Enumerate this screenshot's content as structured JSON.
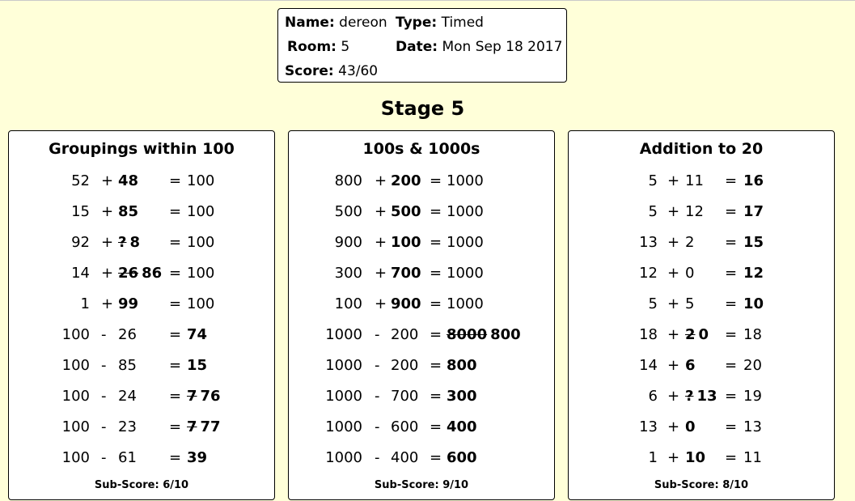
{
  "header": {
    "name_label": "Name:",
    "name_value": "dereon",
    "type_label": "Type:",
    "type_value": "Timed",
    "room_label": "Room:",
    "room_value": "5",
    "date_label": "Date:",
    "date_value": "Mon Sep 18 2017",
    "score_label": "Score:",
    "score_value": "43/60"
  },
  "stage_title": "Stage 5",
  "panels": [
    {
      "title": "Groupings within 100",
      "subscore": "Sub-Score: 6/10",
      "layout": "g1",
      "rows": [
        {
          "a": "52",
          "op": "+",
          "b": "48",
          "b_bold": true,
          "eq": "=",
          "c": "100",
          "c_bold": false,
          "wrong": ""
        },
        {
          "a": "15",
          "op": "+",
          "b": "85",
          "b_bold": true,
          "eq": "=",
          "c": "100",
          "c_bold": false,
          "wrong": ""
        },
        {
          "a": "92",
          "op": "+",
          "b": "8",
          "b_bold": true,
          "eq": "=",
          "c": "100",
          "c_bold": false,
          "wrong": "?",
          "wrong_pos": "b"
        },
        {
          "a": "14",
          "op": "+",
          "b": "86",
          "b_bold": true,
          "eq": "=",
          "c": "100",
          "c_bold": false,
          "wrong": "26",
          "wrong_pos": "b"
        },
        {
          "a": "1",
          "op": "+",
          "b": "99",
          "b_bold": true,
          "eq": "=",
          "c": "100",
          "c_bold": false,
          "wrong": ""
        },
        {
          "a": "100",
          "op": "-",
          "b": "26",
          "b_bold": false,
          "eq": "=",
          "c": "74",
          "c_bold": true,
          "wrong": ""
        },
        {
          "a": "100",
          "op": "-",
          "b": "85",
          "b_bold": false,
          "eq": "=",
          "c": "15",
          "c_bold": true,
          "wrong": ""
        },
        {
          "a": "100",
          "op": "-",
          "b": "24",
          "b_bold": false,
          "eq": "=",
          "c": "76",
          "c_bold": true,
          "wrong": "7",
          "wrong_pos": "c"
        },
        {
          "a": "100",
          "op": "-",
          "b": "23",
          "b_bold": false,
          "eq": "=",
          "c": "77",
          "c_bold": true,
          "wrong": "7",
          "wrong_pos": "c"
        },
        {
          "a": "100",
          "op": "-",
          "b": "61",
          "b_bold": false,
          "eq": "=",
          "c": "39",
          "c_bold": true,
          "wrong": ""
        }
      ]
    },
    {
      "title": "100s & 1000s",
      "subscore": "Sub-Score: 9/10",
      "layout": "g2",
      "rows": [
        {
          "a": "800",
          "op": "+",
          "b": "200",
          "b_bold": true,
          "eq": "=",
          "c": "1000",
          "c_bold": false,
          "wrong": ""
        },
        {
          "a": "500",
          "op": "+",
          "b": "500",
          "b_bold": true,
          "eq": "=",
          "c": "1000",
          "c_bold": false,
          "wrong": ""
        },
        {
          "a": "900",
          "op": "+",
          "b": "100",
          "b_bold": true,
          "eq": "=",
          "c": "1000",
          "c_bold": false,
          "wrong": ""
        },
        {
          "a": "300",
          "op": "+",
          "b": "700",
          "b_bold": true,
          "eq": "=",
          "c": "1000",
          "c_bold": false,
          "wrong": ""
        },
        {
          "a": "100",
          "op": "+",
          "b": "900",
          "b_bold": true,
          "eq": "=",
          "c": "1000",
          "c_bold": false,
          "wrong": ""
        },
        {
          "a": "1000",
          "op": "-",
          "b": "200",
          "b_bold": false,
          "eq": "=",
          "c": "800",
          "c_bold": true,
          "wrong": "8000",
          "wrong_pos": "c"
        },
        {
          "a": "1000",
          "op": "-",
          "b": "200",
          "b_bold": false,
          "eq": "=",
          "c": "800",
          "c_bold": true,
          "wrong": ""
        },
        {
          "a": "1000",
          "op": "-",
          "b": "700",
          "b_bold": false,
          "eq": "=",
          "c": "300",
          "c_bold": true,
          "wrong": ""
        },
        {
          "a": "1000",
          "op": "-",
          "b": "600",
          "b_bold": false,
          "eq": "=",
          "c": "400",
          "c_bold": true,
          "wrong": ""
        },
        {
          "a": "1000",
          "op": "-",
          "b": "400",
          "b_bold": false,
          "eq": "=",
          "c": "600",
          "c_bold": true,
          "wrong": ""
        }
      ]
    },
    {
      "title": "Addition to 20",
      "subscore": "Sub-Score: 8/10",
      "layout": "g3",
      "rows": [
        {
          "a": "5",
          "op": "+",
          "b": "11",
          "b_bold": false,
          "eq": "=",
          "c": "16",
          "c_bold": true,
          "wrong": ""
        },
        {
          "a": "5",
          "op": "+",
          "b": "12",
          "b_bold": false,
          "eq": "=",
          "c": "17",
          "c_bold": true,
          "wrong": ""
        },
        {
          "a": "13",
          "op": "+",
          "b": "2",
          "b_bold": false,
          "eq": "=",
          "c": "15",
          "c_bold": true,
          "wrong": ""
        },
        {
          "a": "12",
          "op": "+",
          "b": "0",
          "b_bold": false,
          "eq": "=",
          "c": "12",
          "c_bold": true,
          "wrong": ""
        },
        {
          "a": "5",
          "op": "+",
          "b": "5",
          "b_bold": false,
          "eq": "=",
          "c": "10",
          "c_bold": true,
          "wrong": ""
        },
        {
          "a": "18",
          "op": "+",
          "b": "0",
          "b_bold": true,
          "eq": "=",
          "c": "18",
          "c_bold": false,
          "wrong": "2",
          "wrong_pos": "b"
        },
        {
          "a": "14",
          "op": "+",
          "b": "6",
          "b_bold": true,
          "eq": "=",
          "c": "20",
          "c_bold": false,
          "wrong": ""
        },
        {
          "a": "6",
          "op": "+",
          "b": "13",
          "b_bold": true,
          "eq": "=",
          "c": "19",
          "c_bold": false,
          "wrong": "?",
          "wrong_pos": "b"
        },
        {
          "a": "13",
          "op": "+",
          "b": "0",
          "b_bold": true,
          "eq": "=",
          "c": "13",
          "c_bold": false,
          "wrong": ""
        },
        {
          "a": "1",
          "op": "+",
          "b": "10",
          "b_bold": true,
          "eq": "=",
          "c": "11",
          "c_bold": false,
          "wrong": ""
        }
      ]
    }
  ]
}
